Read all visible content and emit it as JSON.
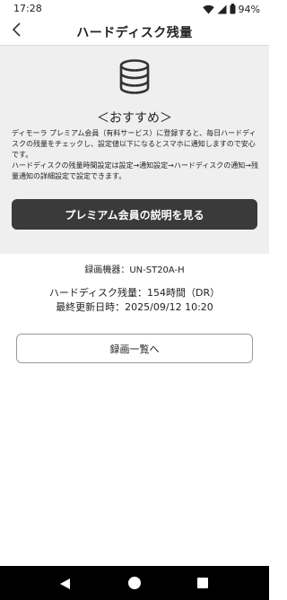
{
  "status_bar": {
    "time": "17:28",
    "battery_percent": "94%",
    "icons": [
      "wifi-icon",
      "signal-icon",
      "battery-icon"
    ]
  },
  "header": {
    "title": "ハードディスク残量",
    "back_icon": "chevron-left-icon"
  },
  "recommend": {
    "icon": "database-icon",
    "title": "＜おすすめ＞",
    "paragraph1": "ディモーラ プレミアム会員（有料サービス）に登録すると、毎日ハードディスクの残量をチェックし、設定値以下になるとスマホに通知しますので安心です。",
    "paragraph2": "ハードディスクの残量時間設定は設定→通知設定→ハードディスクの通知→残量通知の詳細設定で設定できます。",
    "button_label": "プレミアム会員の説明を見る"
  },
  "info": {
    "device_line": "録画機器：UN-ST20A-H",
    "remaining_line": "ハードディスク残量：154時間（DR）",
    "updated_line": "最終更新日時：2025/09/12 10:20"
  },
  "recordings_button_label": "録画一覧へ",
  "colors": {
    "panel_bg": "#efefef",
    "primary_button": "#3a3a3a",
    "nav_bar": "#000000"
  },
  "nav_bar": {
    "icons": [
      "nav-back-icon",
      "nav-home-icon",
      "nav-recents-icon"
    ]
  }
}
